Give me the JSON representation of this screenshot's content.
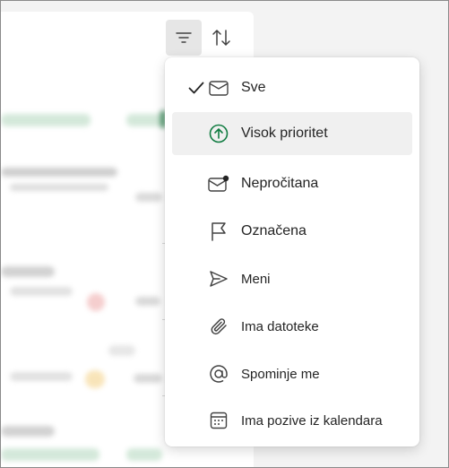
{
  "toolbar": {
    "filter_icon": "filter-icon",
    "sort_icon": "sort-icon"
  },
  "filter_menu": {
    "selected": "Sve",
    "highlighted": "Visok prioritet",
    "items": [
      {
        "label": "Sve",
        "icon": "mail-icon",
        "checked": true
      },
      {
        "label": "Visok prioritet",
        "icon": "arrow-up-circle-icon",
        "checked": false
      },
      {
        "label": "Nepročitana",
        "icon": "mail-unread-icon",
        "checked": false
      },
      {
        "label": "Označena",
        "icon": "flag-icon",
        "checked": false
      },
      {
        "label": "Meni",
        "icon": "send-icon",
        "checked": false
      },
      {
        "label": "Ima datoteke",
        "icon": "attach-icon",
        "checked": false
      },
      {
        "label": "Spominje me",
        "icon": "mention-icon",
        "checked": false
      },
      {
        "label": "Ima pozive iz kalendara",
        "icon": "calendar-icon",
        "checked": false
      }
    ]
  },
  "colors": {
    "accent_green": "#107c41",
    "menu_background": "#ffffff",
    "hover_background": "#f0f0f0"
  }
}
